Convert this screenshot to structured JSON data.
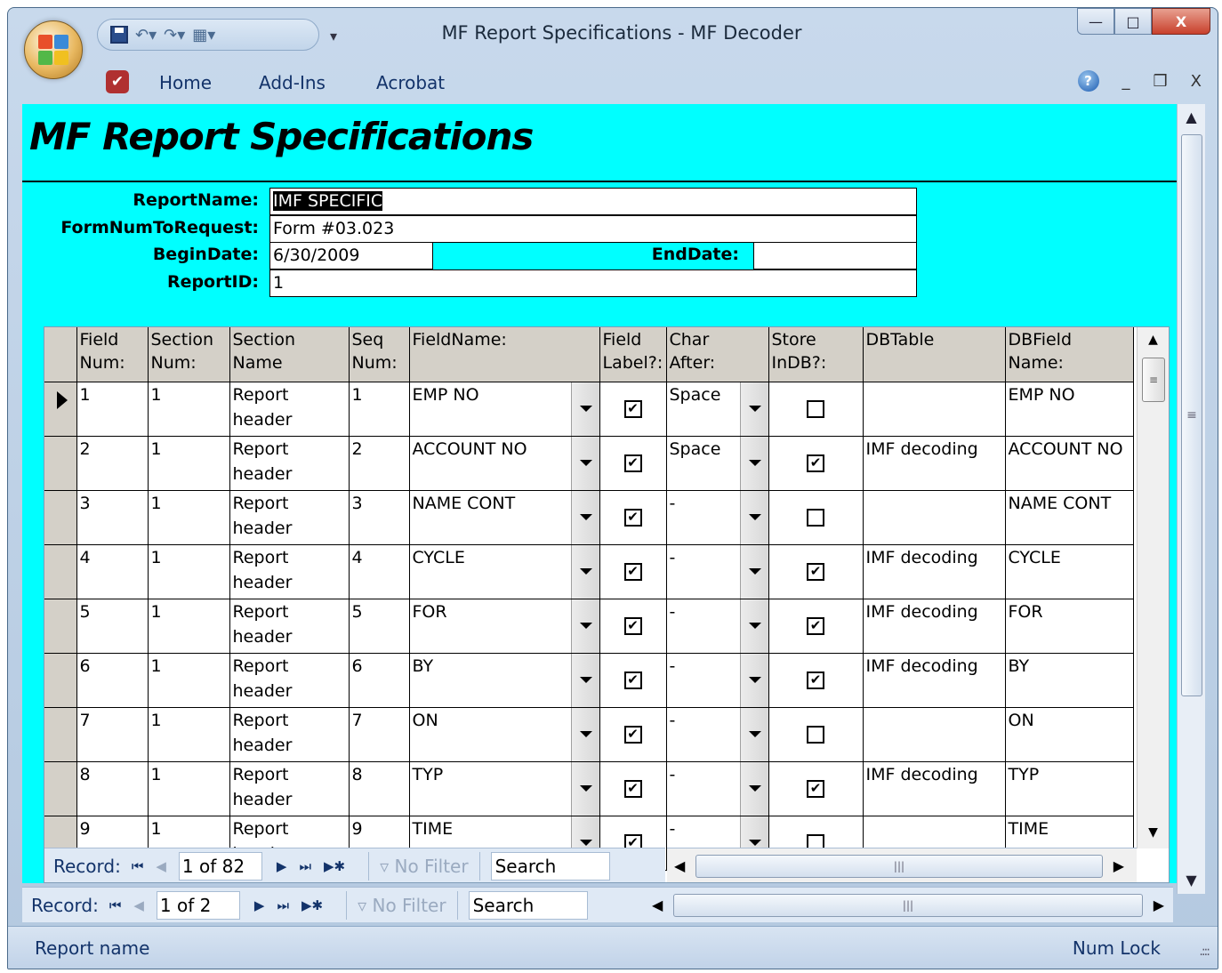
{
  "window": {
    "title": "MF Report Specifications - MF Decoder",
    "min_label": "—",
    "max_label": "□",
    "close_label": "X"
  },
  "ribbon": {
    "tabs": [
      "Home",
      "Add-Ins",
      "Acrobat"
    ],
    "help_label": "?",
    "min_label": "_",
    "restore_label": "❒",
    "close_label": "X"
  },
  "form": {
    "title": "MF Report Specifications",
    "report_name_label": "ReportName:",
    "report_name_value": "IMF SPECIFIC",
    "form_num_label": "FormNumToRequest:",
    "form_num_value": "Form #03.023",
    "begin_date_label": "BeginDate:",
    "begin_date_value": "6/30/2009",
    "end_date_label": "EndDate:",
    "end_date_value": "",
    "report_id_label": "ReportID:",
    "report_id_value": "1"
  },
  "grid": {
    "headers": {
      "field_num": [
        "Field",
        "Num:"
      ],
      "section_num": [
        "Section",
        "Num:"
      ],
      "section_name": [
        "Section",
        "Name"
      ],
      "seq_num": [
        "Seq",
        "Num:"
      ],
      "field_name": [
        "FieldName:",
        ""
      ],
      "field_label": [
        "Field",
        "Label?:"
      ],
      "char_after": [
        "Char",
        "After:"
      ],
      "store_indb": [
        "Store",
        "InDB?:"
      ],
      "dbtable": [
        "DBTable",
        ""
      ],
      "dbfield": [
        "DBField",
        "Name:"
      ]
    },
    "rows": [
      {
        "field_num": "1",
        "section_num": "1",
        "section_name": [
          "Report",
          "header"
        ],
        "seq_num": "1",
        "field_name": "EMP NO",
        "field_label": true,
        "char_after": "Space",
        "store_indb": false,
        "dbtable": "",
        "dbfield": "EMP NO"
      },
      {
        "field_num": "2",
        "section_num": "1",
        "section_name": [
          "Report",
          "header"
        ],
        "seq_num": "2",
        "field_name": "ACCOUNT NO",
        "field_label": true,
        "char_after": "Space",
        "store_indb": true,
        "dbtable": "IMF decoding",
        "dbfield": "ACCOUNT NO"
      },
      {
        "field_num": "3",
        "section_num": "1",
        "section_name": [
          "Report",
          "header"
        ],
        "seq_num": "3",
        "field_name": "NAME CONT",
        "field_label": true,
        "char_after": "-",
        "store_indb": false,
        "dbtable": "",
        "dbfield": "NAME CONT"
      },
      {
        "field_num": "4",
        "section_num": "1",
        "section_name": [
          "Report",
          "header"
        ],
        "seq_num": "4",
        "field_name": "CYCLE",
        "field_label": true,
        "char_after": "-",
        "store_indb": true,
        "dbtable": "IMF decoding",
        "dbfield": "CYCLE"
      },
      {
        "field_num": "5",
        "section_num": "1",
        "section_name": [
          "Report",
          "header"
        ],
        "seq_num": "5",
        "field_name": "FOR",
        "field_label": true,
        "char_after": "-",
        "store_indb": true,
        "dbtable": "IMF decoding",
        "dbfield": "FOR"
      },
      {
        "field_num": "6",
        "section_num": "1",
        "section_name": [
          "Report",
          "header"
        ],
        "seq_num": "6",
        "field_name": "BY",
        "field_label": true,
        "char_after": "-",
        "store_indb": true,
        "dbtable": "IMF decoding",
        "dbfield": "BY"
      },
      {
        "field_num": "7",
        "section_num": "1",
        "section_name": [
          "Report",
          "header"
        ],
        "seq_num": "7",
        "field_name": "ON",
        "field_label": true,
        "char_after": "-",
        "store_indb": false,
        "dbtable": "",
        "dbfield": "ON"
      },
      {
        "field_num": "8",
        "section_num": "1",
        "section_name": [
          "Report",
          "header"
        ],
        "seq_num": "8",
        "field_name": "TYP",
        "field_label": true,
        "char_after": "-",
        "store_indb": true,
        "dbtable": "IMF decoding",
        "dbfield": "TYP"
      },
      {
        "field_num": "9",
        "section_num": "1",
        "section_name": [
          "Report",
          "header"
        ],
        "seq_num": "9",
        "field_name": "TIME",
        "field_label": true,
        "char_after": "-",
        "store_indb": false,
        "dbtable": "",
        "dbfield": "TIME"
      }
    ]
  },
  "sub_nav": {
    "record_label": "Record:",
    "position": "1 of 82",
    "no_filter_label": "No Filter",
    "search_placeholder": "Search"
  },
  "main_nav": {
    "record_label": "Record:",
    "position": "1 of 2",
    "no_filter_label": "No Filter",
    "search_placeholder": "Search"
  },
  "status": {
    "left": "Report name",
    "right": "Num Lock"
  }
}
